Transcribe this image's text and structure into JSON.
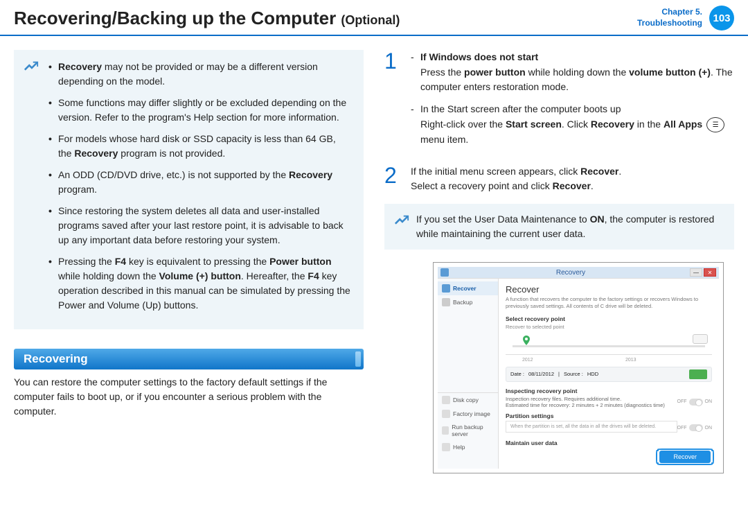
{
  "header": {
    "title_main": "Recovering/Backing up the Computer",
    "title_optional": "(Optional)",
    "chapter_line1": "Chapter 5.",
    "chapter_line2": "Troubleshooting",
    "page_number": "103"
  },
  "notes": [
    {
      "pre": "",
      "b1": "Recovery",
      "mid": " may not be provided or may be a different version depending on the model.",
      "b2": "",
      "post": ""
    },
    {
      "pre": "Some functions may differ slightly or be excluded depending on the version. Refer to the program's Help section for more information.",
      "b1": "",
      "mid": "",
      "b2": "",
      "post": ""
    },
    {
      "pre": "For models whose hard disk or SSD capacity is less than 64 GB, the ",
      "b1": "Recovery",
      "mid": " program is not provided.",
      "b2": "",
      "post": ""
    },
    {
      "pre": "An ODD (CD/DVD drive, etc.) is not supported by the ",
      "b1": "Recovery",
      "mid": " program.",
      "b2": "",
      "post": ""
    },
    {
      "pre": "Since restoring the system deletes all data and user-installed programs saved after your last restore point, it is advisable to back up any important data before restoring your system.",
      "b1": "",
      "mid": "",
      "b2": "",
      "post": ""
    },
    {
      "pre": "Pressing the ",
      "b1": "F4",
      "mid": " key is equivalent to pressing the ",
      "b2": "Power button",
      "post": " while holding down the ",
      "b3": "Volume (+) button",
      "post2": ". Hereafter, the ",
      "b4": "F4",
      "post3": " key operation described in this manual can be simulated by pressing the Power and Volume (Up) buttons."
    }
  ],
  "section_title": "Recovering",
  "section_text": "You can restore the computer settings to the factory default settings if the computer fails to boot up, or if you encounter a serious problem with the computer.",
  "step1": {
    "num": "1",
    "sub1_b": "If Windows does not start",
    "sub1_p1a": "Press the ",
    "sub1_p1b1": "power button",
    "sub1_p1c": " while holding down the ",
    "sub1_p1b2": "volume button (+)",
    "sub1_p1d": ". The computer enters restoration mode.",
    "sub2_a": "In the Start screen after the computer boots up",
    "sub2_b1": "Right-click over the ",
    "sub2_b1b": "Start screen",
    "sub2_b2": ". Click ",
    "sub2_b2b": "Recovery",
    "sub2_b3": " in the ",
    "sub2_b3b": "All Apps",
    "sub2_b4": " menu item."
  },
  "step2": {
    "num": "2",
    "line1a": "If the initial menu screen appears, click ",
    "line1b": "Recover",
    "line1c": ".",
    "line2a": "Select a recovery point and click ",
    "line2b": "Recover",
    "line2c": "."
  },
  "note2": {
    "a": "If you set the User Data Maintenance to ",
    "b": "ON",
    "c": ", the computer is restored while maintaining the current user data."
  },
  "screenshot": {
    "window_title": "Recovery",
    "side_recover": "Recover",
    "side_backup": "Backup",
    "side_diskcopy": "Disk copy",
    "side_factory": "Factory image",
    "side_runbackup": "Run backup server",
    "side_help": "Help",
    "main_title": "Recover",
    "main_sub": "A function that recovers the computer to the factory settings or recovers Windows to previously saved settings. All contents of C drive will be deleted.",
    "sec_select": "Select recovery point",
    "sec_select_sub": "Recover to selected point",
    "year1": "2012",
    "year2": "2013",
    "meta_date_label": "Date :",
    "meta_date_val": "08/11/2012",
    "meta_src_label": "Source :",
    "meta_src_val": "HDD",
    "sec_inspect": "Inspecting recovery point",
    "inspect_line": "Inspection recovery files. Requires additional time.\nEstimated time for recovery: 2 minutes + 2 minutes (diagnostics time)",
    "toggle_off": "OFF",
    "toggle_on": "ON",
    "sec_partition": "Partition settings",
    "partition_line": "When the partition is set, all the data in all the drives will be deleted.",
    "sec_maintain": "Maintain user data",
    "recover_btn": "Recover"
  }
}
